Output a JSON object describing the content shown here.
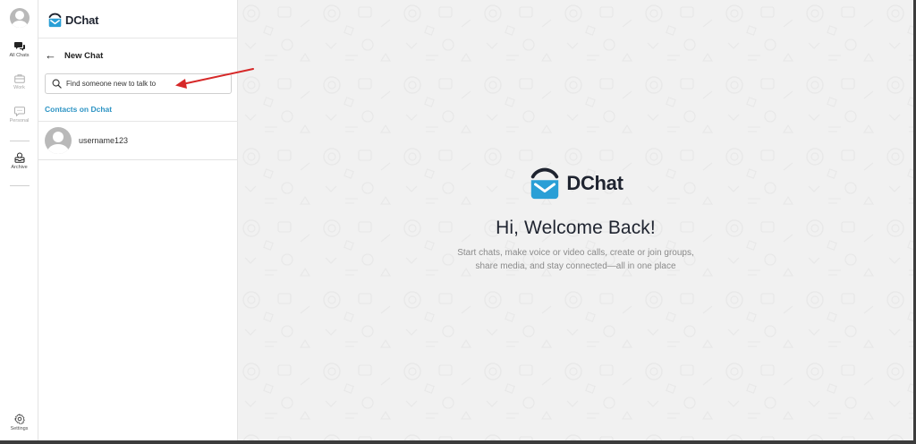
{
  "rail": {
    "items": [
      {
        "label": "All Chats",
        "icon": "chat-bubbles-icon",
        "active": true
      },
      {
        "label": "Work",
        "icon": "briefcase-icon"
      },
      {
        "label": "Personal",
        "icon": "message-icon"
      },
      {
        "label": "Archive",
        "icon": "archive-icon"
      }
    ],
    "settings_label": "Settings"
  },
  "sidebar": {
    "brand": "DChat",
    "header_title": "New Chat",
    "search_placeholder": "Find someone new to talk to",
    "contacts_title": "Contacts on Dchat",
    "contacts": [
      {
        "username": "username123"
      }
    ]
  },
  "main": {
    "brand": "DChat",
    "heading": "Hi, Welcome Back!",
    "subtext_line1": "Start chats, make voice or video calls, create or join groups,",
    "subtext_line2": "share media, and stay connected—all in one place"
  },
  "colors": {
    "accent": "#2d94c4",
    "logo_blue": "#2a9fd6",
    "annotation_arrow": "#d62828"
  }
}
